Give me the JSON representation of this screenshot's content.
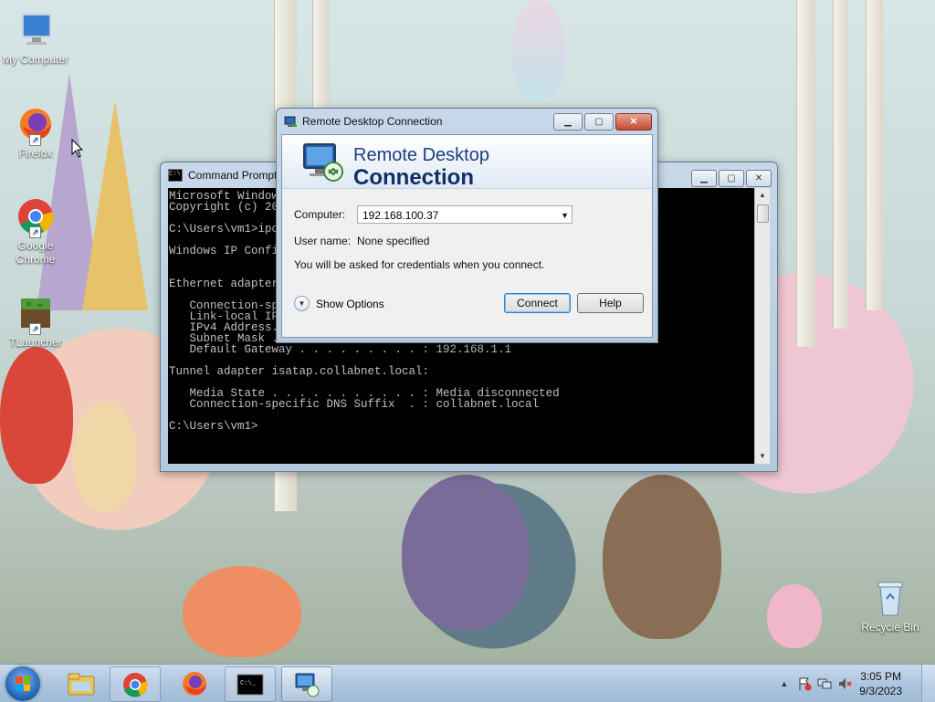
{
  "desktop": {
    "icons": [
      {
        "label": "My Computer"
      },
      {
        "label": "Firefox"
      },
      {
        "label": "Google Chrome"
      },
      {
        "label": "TLauncher"
      },
      {
        "label": "Recycle Bin"
      }
    ]
  },
  "cmd_window": {
    "title": "Command Prompt",
    "lines": [
      "Microsoft Windows [Version 6.1.7601]",
      "Copyright (c) 2009 Microsoft Corporation.  All rights reserved.",
      "",
      "C:\\Users\\vm1>ipconfig",
      "",
      "Windows IP Configuration",
      "",
      "",
      "Ethernet adapter Local Area Connection:",
      "",
      "   Connection-specific DNS Suffix  . : collabnet.local",
      "   Link-local IPv6 Address . . . . . : fe80::1c4a:2d1f:9e3b:7a21%11",
      "   IPv4 Address. . . . . . . . . . . : 192.168.1.23",
      "   Subnet Mask . . . . . . . . . . . : 255.255.255.0",
      "   Default Gateway . . . . . . . . . : 192.168.1.1",
      "",
      "Tunnel adapter isatap.collabnet.local:",
      "",
      "   Media State . . . . . . . . . . . : Media disconnected",
      "   Connection-specific DNS Suffix  . : collabnet.local",
      "",
      "C:\\Users\\vm1>"
    ]
  },
  "rdc_window": {
    "title": "Remote Desktop Connection",
    "banner_line1": "Remote Desktop",
    "banner_line2": "Connection",
    "computer_label": "Computer:",
    "computer_value": "192.168.100.37",
    "username_label": "User name:",
    "username_value": "None specified",
    "credentials_note": "You will be asked for credentials when you connect.",
    "show_options_label": "Show Options",
    "connect_label": "Connect",
    "help_label": "Help"
  },
  "taskbar": {
    "clock_time": "3:05 PM",
    "clock_date": "9/3/2023",
    "tray_chevron": "▲"
  }
}
